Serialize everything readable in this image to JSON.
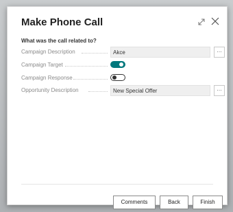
{
  "dialog": {
    "title": "Make Phone Call",
    "section_heading": "What was the call related to?"
  },
  "fields": [
    {
      "label": "Campaign Description",
      "value": "Akce",
      "assist": "…"
    },
    {
      "label": "Campaign Target",
      "toggle": "on"
    },
    {
      "label": "Campaign Response",
      "toggle": "off"
    },
    {
      "label": "Opportunity Description",
      "value": "New Special Offer",
      "assist": "…"
    }
  ],
  "buttons": {
    "comments": "Comments",
    "back": "Back",
    "finish": "Finish"
  },
  "colors": {
    "toggle_on": "#00787d"
  }
}
